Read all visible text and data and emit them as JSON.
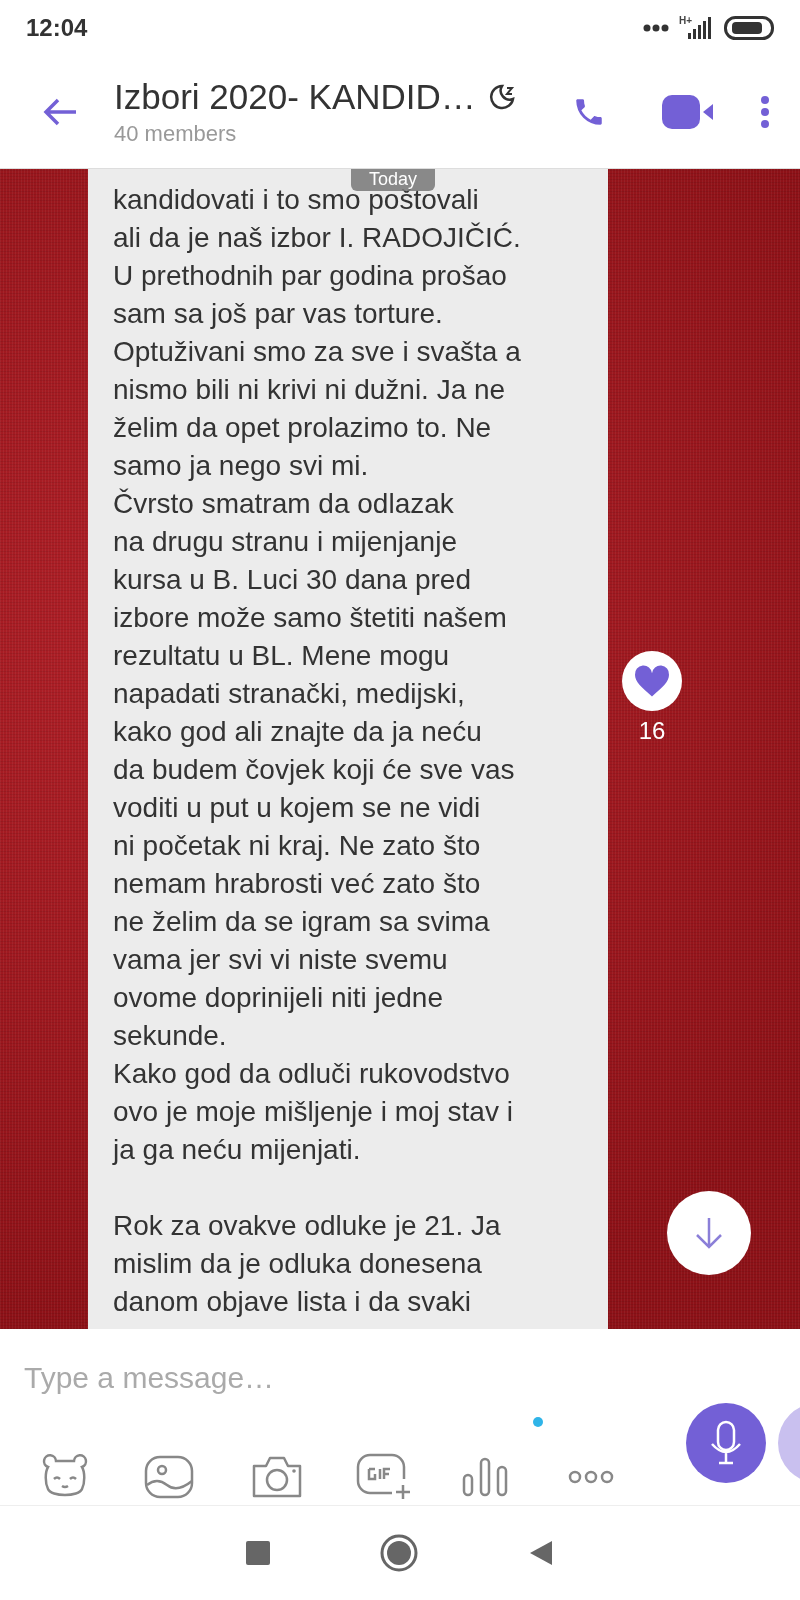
{
  "status_bar": {
    "time": "12:04",
    "network": "H+"
  },
  "header": {
    "title": "Izbori 2020- KANDID…",
    "subtitle": "40 members"
  },
  "chat": {
    "date_chip": "Today",
    "message": {
      "paragraphs": [
        [
          "kandidovati i to smo poštovali",
          "ali da je naš izbor I. RADOJIČIĆ.",
          "U prethodnih par godina prošao",
          "sam sa još par vas torture.",
          "Optuživani smo za sve i svašta a",
          "nismo bili ni krivi ni dužni. Ja ne",
          "želim da opet prolazimo to. Ne",
          "samo ja nego svi mi.",
          "Čvrsto smatram da odlazak",
          "na drugu stranu i mijenjanje",
          "kursa u B. Luci 30 dana pred",
          "izbore može samo štetiti našem",
          "rezultatu u BL. Mene mogu",
          "napadati stranački, medijski,",
          "kako god ali znajte da ja neću",
          "da budem čovjek koji će sve vas",
          "voditi u put u kojem se ne vidi",
          "ni početak ni kraj. Ne zato što",
          "nemam hrabrosti već zato što",
          "ne želim da se igram sa svima",
          "vama jer svi vi niste svemu",
          "ovome doprinijeli niti jedne",
          "sekunde.",
          "Kako god da odluči rukovodstvo",
          "ovo je moje mišljenje i moj stav i",
          "ja ga neću mijenjati."
        ],
        [
          "Rok za ovakve odluke je 21. Ja",
          "mislim da je odluka donesena",
          "danom objave lista i da svaki"
        ]
      ],
      "likes": "16"
    }
  },
  "composer": {
    "placeholder": "Type a message…"
  }
}
